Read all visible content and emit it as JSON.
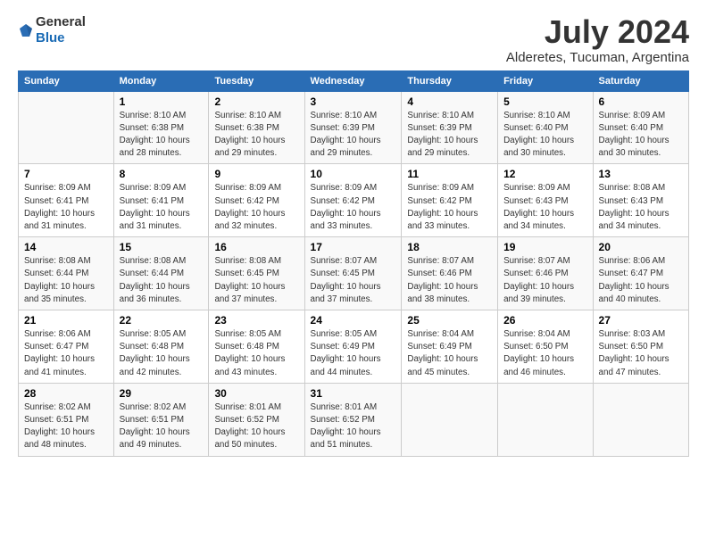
{
  "header": {
    "logo_general": "General",
    "logo_blue": "Blue",
    "title": "July 2024",
    "subtitle": "Alderetes, Tucuman, Argentina"
  },
  "days_of_week": [
    "Sunday",
    "Monday",
    "Tuesday",
    "Wednesday",
    "Thursday",
    "Friday",
    "Saturday"
  ],
  "weeks": [
    [
      {
        "num": "",
        "info": ""
      },
      {
        "num": "1",
        "info": "Sunrise: 8:10 AM\nSunset: 6:38 PM\nDaylight: 10 hours and 28 minutes."
      },
      {
        "num": "2",
        "info": "Sunrise: 8:10 AM\nSunset: 6:38 PM\nDaylight: 10 hours and 29 minutes."
      },
      {
        "num": "3",
        "info": "Sunrise: 8:10 AM\nSunset: 6:39 PM\nDaylight: 10 hours and 29 minutes."
      },
      {
        "num": "4",
        "info": "Sunrise: 8:10 AM\nSunset: 6:39 PM\nDaylight: 10 hours and 29 minutes."
      },
      {
        "num": "5",
        "info": "Sunrise: 8:10 AM\nSunset: 6:40 PM\nDaylight: 10 hours and 30 minutes."
      },
      {
        "num": "6",
        "info": "Sunrise: 8:09 AM\nSunset: 6:40 PM\nDaylight: 10 hours and 30 minutes."
      }
    ],
    [
      {
        "num": "7",
        "info": "Sunrise: 8:09 AM\nSunset: 6:41 PM\nDaylight: 10 hours and 31 minutes."
      },
      {
        "num": "8",
        "info": "Sunrise: 8:09 AM\nSunset: 6:41 PM\nDaylight: 10 hours and 31 minutes."
      },
      {
        "num": "9",
        "info": "Sunrise: 8:09 AM\nSunset: 6:42 PM\nDaylight: 10 hours and 32 minutes."
      },
      {
        "num": "10",
        "info": "Sunrise: 8:09 AM\nSunset: 6:42 PM\nDaylight: 10 hours and 33 minutes."
      },
      {
        "num": "11",
        "info": "Sunrise: 8:09 AM\nSunset: 6:42 PM\nDaylight: 10 hours and 33 minutes."
      },
      {
        "num": "12",
        "info": "Sunrise: 8:09 AM\nSunset: 6:43 PM\nDaylight: 10 hours and 34 minutes."
      },
      {
        "num": "13",
        "info": "Sunrise: 8:08 AM\nSunset: 6:43 PM\nDaylight: 10 hours and 34 minutes."
      }
    ],
    [
      {
        "num": "14",
        "info": "Sunrise: 8:08 AM\nSunset: 6:44 PM\nDaylight: 10 hours and 35 minutes."
      },
      {
        "num": "15",
        "info": "Sunrise: 8:08 AM\nSunset: 6:44 PM\nDaylight: 10 hours and 36 minutes."
      },
      {
        "num": "16",
        "info": "Sunrise: 8:08 AM\nSunset: 6:45 PM\nDaylight: 10 hours and 37 minutes."
      },
      {
        "num": "17",
        "info": "Sunrise: 8:07 AM\nSunset: 6:45 PM\nDaylight: 10 hours and 37 minutes."
      },
      {
        "num": "18",
        "info": "Sunrise: 8:07 AM\nSunset: 6:46 PM\nDaylight: 10 hours and 38 minutes."
      },
      {
        "num": "19",
        "info": "Sunrise: 8:07 AM\nSunset: 6:46 PM\nDaylight: 10 hours and 39 minutes."
      },
      {
        "num": "20",
        "info": "Sunrise: 8:06 AM\nSunset: 6:47 PM\nDaylight: 10 hours and 40 minutes."
      }
    ],
    [
      {
        "num": "21",
        "info": "Sunrise: 8:06 AM\nSunset: 6:47 PM\nDaylight: 10 hours and 41 minutes."
      },
      {
        "num": "22",
        "info": "Sunrise: 8:05 AM\nSunset: 6:48 PM\nDaylight: 10 hours and 42 minutes."
      },
      {
        "num": "23",
        "info": "Sunrise: 8:05 AM\nSunset: 6:48 PM\nDaylight: 10 hours and 43 minutes."
      },
      {
        "num": "24",
        "info": "Sunrise: 8:05 AM\nSunset: 6:49 PM\nDaylight: 10 hours and 44 minutes."
      },
      {
        "num": "25",
        "info": "Sunrise: 8:04 AM\nSunset: 6:49 PM\nDaylight: 10 hours and 45 minutes."
      },
      {
        "num": "26",
        "info": "Sunrise: 8:04 AM\nSunset: 6:50 PM\nDaylight: 10 hours and 46 minutes."
      },
      {
        "num": "27",
        "info": "Sunrise: 8:03 AM\nSunset: 6:50 PM\nDaylight: 10 hours and 47 minutes."
      }
    ],
    [
      {
        "num": "28",
        "info": "Sunrise: 8:02 AM\nSunset: 6:51 PM\nDaylight: 10 hours and 48 minutes."
      },
      {
        "num": "29",
        "info": "Sunrise: 8:02 AM\nSunset: 6:51 PM\nDaylight: 10 hours and 49 minutes."
      },
      {
        "num": "30",
        "info": "Sunrise: 8:01 AM\nSunset: 6:52 PM\nDaylight: 10 hours and 50 minutes."
      },
      {
        "num": "31",
        "info": "Sunrise: 8:01 AM\nSunset: 6:52 PM\nDaylight: 10 hours and 51 minutes."
      },
      {
        "num": "",
        "info": ""
      },
      {
        "num": "",
        "info": ""
      },
      {
        "num": "",
        "info": ""
      }
    ]
  ]
}
